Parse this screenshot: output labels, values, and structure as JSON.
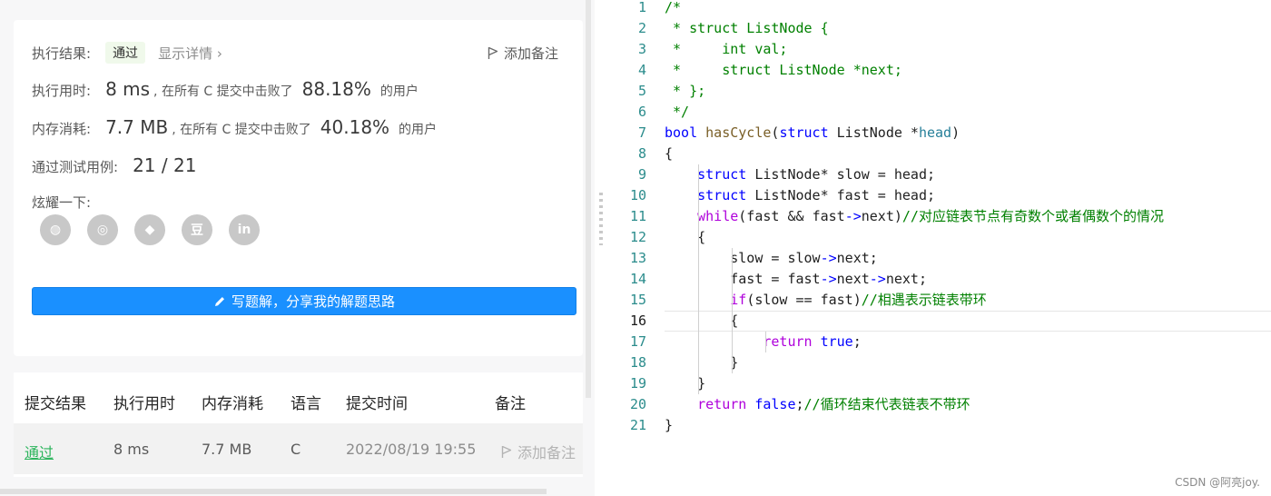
{
  "result": {
    "status_label": "执行结果:",
    "status_value": "通过",
    "details_link": "显示详情 ›",
    "add_note": "添加备注",
    "time_label": "执行用时:",
    "time_value": "8 ms",
    "time_text": ", 在所有 C 提交中击败了",
    "time_percent": "88.18%",
    "time_suffix": "的用户",
    "mem_label": "内存消耗:",
    "mem_value": "7.7 MB",
    "mem_text": ", 在所有 C 提交中击败了",
    "mem_percent": "40.18%",
    "mem_suffix": "的用户",
    "tests_label": "通过测试用例:",
    "tests_value": "21 / 21",
    "share_label": "炫耀一下:",
    "share_icons": [
      "wechat-icon",
      "weibo-icon",
      "qq-icon",
      "douban-icon",
      "linkedin-icon"
    ],
    "share_glyphs": [
      "◍",
      "◎",
      "◆",
      "豆",
      "in"
    ],
    "write_button": "写题解，分享我的解题思路"
  },
  "submissions": {
    "headers": [
      "提交结果",
      "执行用时",
      "内存消耗",
      "语言",
      "提交时间",
      "备注"
    ],
    "row": {
      "status": "通过",
      "time": "8 ms",
      "memory": "7.7 MB",
      "language": "C",
      "submitted": "2022/08/19 19:55",
      "note": "添加备注"
    }
  },
  "editor": {
    "current_line": 16,
    "lines": [
      [
        [
          "/*",
          "cm"
        ]
      ],
      [
        [
          " * struct ListNode {",
          "cm"
        ]
      ],
      [
        [
          " *     int val;",
          "cm"
        ]
      ],
      [
        [
          " *     struct ListNode *next;",
          "cm"
        ]
      ],
      [
        [
          " * };",
          "cm"
        ]
      ],
      [
        [
          " */",
          "cm"
        ]
      ],
      [
        [
          "bool",
          "kw"
        ],
        [
          " ",
          "df"
        ],
        [
          "hasCycle",
          "fn"
        ],
        [
          "(",
          "df"
        ],
        [
          "struct",
          "kw"
        ],
        [
          " ListNode *",
          "df"
        ],
        [
          "head",
          "ty"
        ],
        [
          ")",
          "df"
        ]
      ],
      [
        [
          "{",
          "df"
        ]
      ],
      [
        [
          "    ",
          "df"
        ],
        [
          "struct",
          "kw"
        ],
        [
          " ListNode* slow = head;",
          "df"
        ]
      ],
      [
        [
          "    ",
          "df"
        ],
        [
          "struct",
          "kw"
        ],
        [
          " ListNode* fast = head;",
          "df"
        ]
      ],
      [
        [
          "    ",
          "df"
        ],
        [
          "while",
          "ctl"
        ],
        [
          "(fast && ",
          "df"
        ],
        [
          "fast",
          "df"
        ],
        [
          "->",
          "kw"
        ],
        [
          "next",
          "df"
        ],
        [
          ")",
          "df"
        ],
        [
          "//对应链表节点有奇数个或者偶数个的情况",
          "cm"
        ]
      ],
      [
        [
          "    {",
          "df"
        ]
      ],
      [
        [
          "        slow = ",
          "df"
        ],
        [
          "slow",
          "df"
        ],
        [
          "->",
          "kw"
        ],
        [
          "next;",
          "df"
        ]
      ],
      [
        [
          "        fast = ",
          "df"
        ],
        [
          "fast",
          "df"
        ],
        [
          "->",
          "kw"
        ],
        [
          "next",
          "df"
        ],
        [
          "->",
          "kw"
        ],
        [
          "next;",
          "df"
        ]
      ],
      [
        [
          "        ",
          "df"
        ],
        [
          "if",
          "ctl"
        ],
        [
          "(slow == fast)",
          "df"
        ],
        [
          "//相遇表示链表带环",
          "cm"
        ]
      ],
      [
        [
          "        {",
          "df"
        ]
      ],
      [
        [
          "            ",
          "df"
        ],
        [
          "return",
          "ctl"
        ],
        [
          " ",
          "df"
        ],
        [
          "true",
          "kw"
        ],
        [
          ";",
          "df"
        ]
      ],
      [
        [
          "        }",
          "df"
        ]
      ],
      [
        [
          "    }",
          "df"
        ]
      ],
      [
        [
          "    ",
          "df"
        ],
        [
          "return",
          "ctl"
        ],
        [
          " ",
          "df"
        ],
        [
          "false",
          "kw"
        ],
        [
          ";",
          "df"
        ],
        [
          "//循环结束代表链表不带环",
          "cm"
        ]
      ],
      [
        [
          "}",
          "df"
        ]
      ]
    ]
  },
  "watermark": "CSDN @阿亮joy."
}
